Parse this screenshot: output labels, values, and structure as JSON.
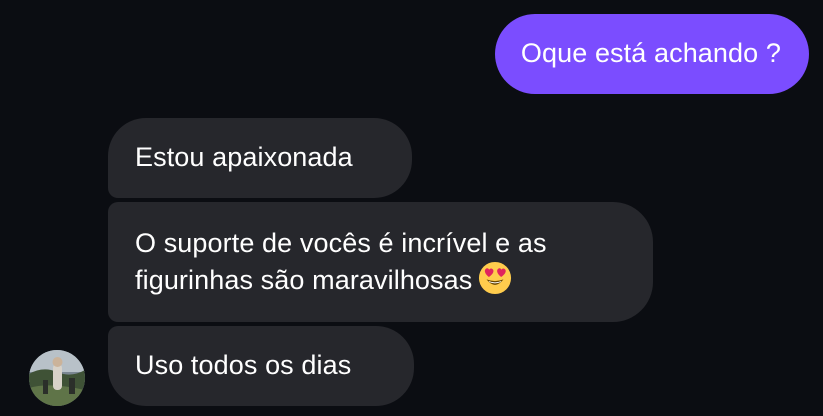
{
  "conversation": {
    "outgoing": [
      {
        "text": "Oque está achando ?"
      }
    ],
    "incoming": [
      {
        "text": "Estou apaixonada"
      },
      {
        "lines": [
          "O suporte de vocês é incrível e as",
          "figurinhas são maravilhosas"
        ],
        "emoji": "smiling-face-with-heart-eyes"
      },
      {
        "text": "Uso todos os dias"
      }
    ]
  },
  "colors": {
    "background": "#0b0d12",
    "outgoing_bubble": "#7b4dff",
    "incoming_bubble": "#26272c",
    "text": "#ffffff"
  },
  "icons": {
    "avatar": "contact-avatar-photo",
    "emoji": "heart-eyes-emoji"
  }
}
